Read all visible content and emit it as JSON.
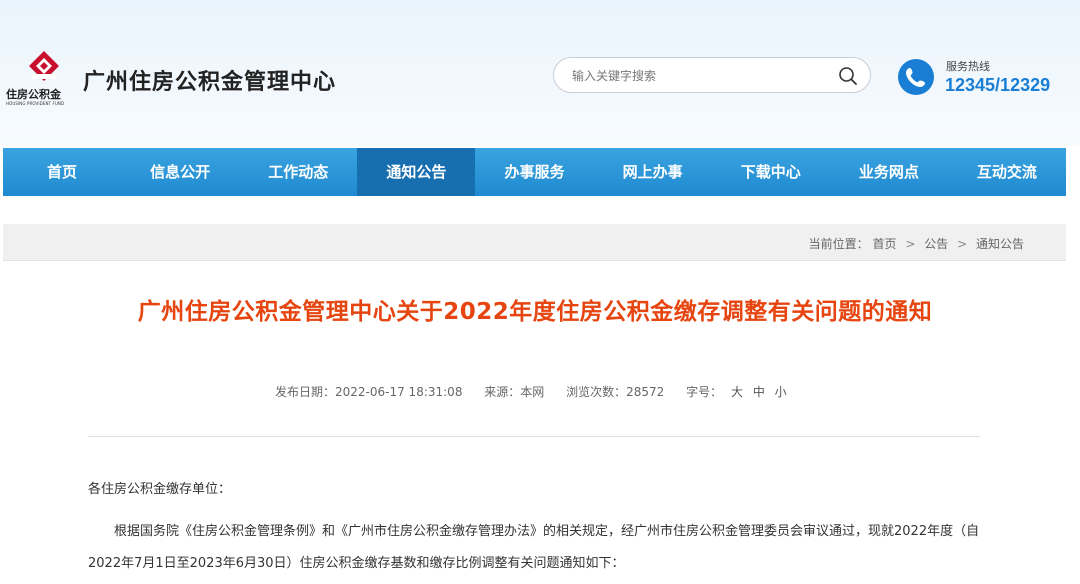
{
  "header": {
    "logo_text": "住房公积金",
    "logo_sub": "HOUSING PROVIDENT FUND",
    "site_title": "广州住房公积金管理中心",
    "search": {
      "placeholder": "输入关键字搜索"
    },
    "hotline": {
      "label": "服务热线",
      "number": "12345/12329"
    },
    "colors": {
      "brand_red": "#c8102e",
      "accent_blue": "#1a7fd4"
    }
  },
  "nav": {
    "items": [
      {
        "label": "首页"
      },
      {
        "label": "信息公开"
      },
      {
        "label": "工作动态"
      },
      {
        "label": "通知公告",
        "active": true
      },
      {
        "label": "办事服务"
      },
      {
        "label": "网上办事"
      },
      {
        "label": "下载中心"
      },
      {
        "label": "业务网点"
      },
      {
        "label": "互动交流"
      }
    ]
  },
  "breadcrumb": {
    "prefix": "当前位置：",
    "items": [
      "首页",
      "公告",
      "通知公告"
    ],
    "separator": ">"
  },
  "article": {
    "title": "广州住房公积金管理中心关于2022年度住房公积金缴存调整有关问题的通知",
    "meta": {
      "date_label": "发布日期：2022-06-17 18:31:08",
      "source_label": "来源：本网",
      "views_label": "浏览次数：28572",
      "font_size_label": "字号：",
      "font_sizes": [
        "大",
        "中",
        "小"
      ]
    },
    "greeting": "各住房公积金缴存单位：",
    "paragraph_1": "根据国务院《住房公积金管理条例》和《广州市住房公积金缴存管理办法》的相关规定，经广州市住房公积金管理委员会审议通过，现就2022年度（自2022年7月1日至2023年6月30日）住房公积金缴存基数和缴存比例调整有关问题通知如下："
  }
}
